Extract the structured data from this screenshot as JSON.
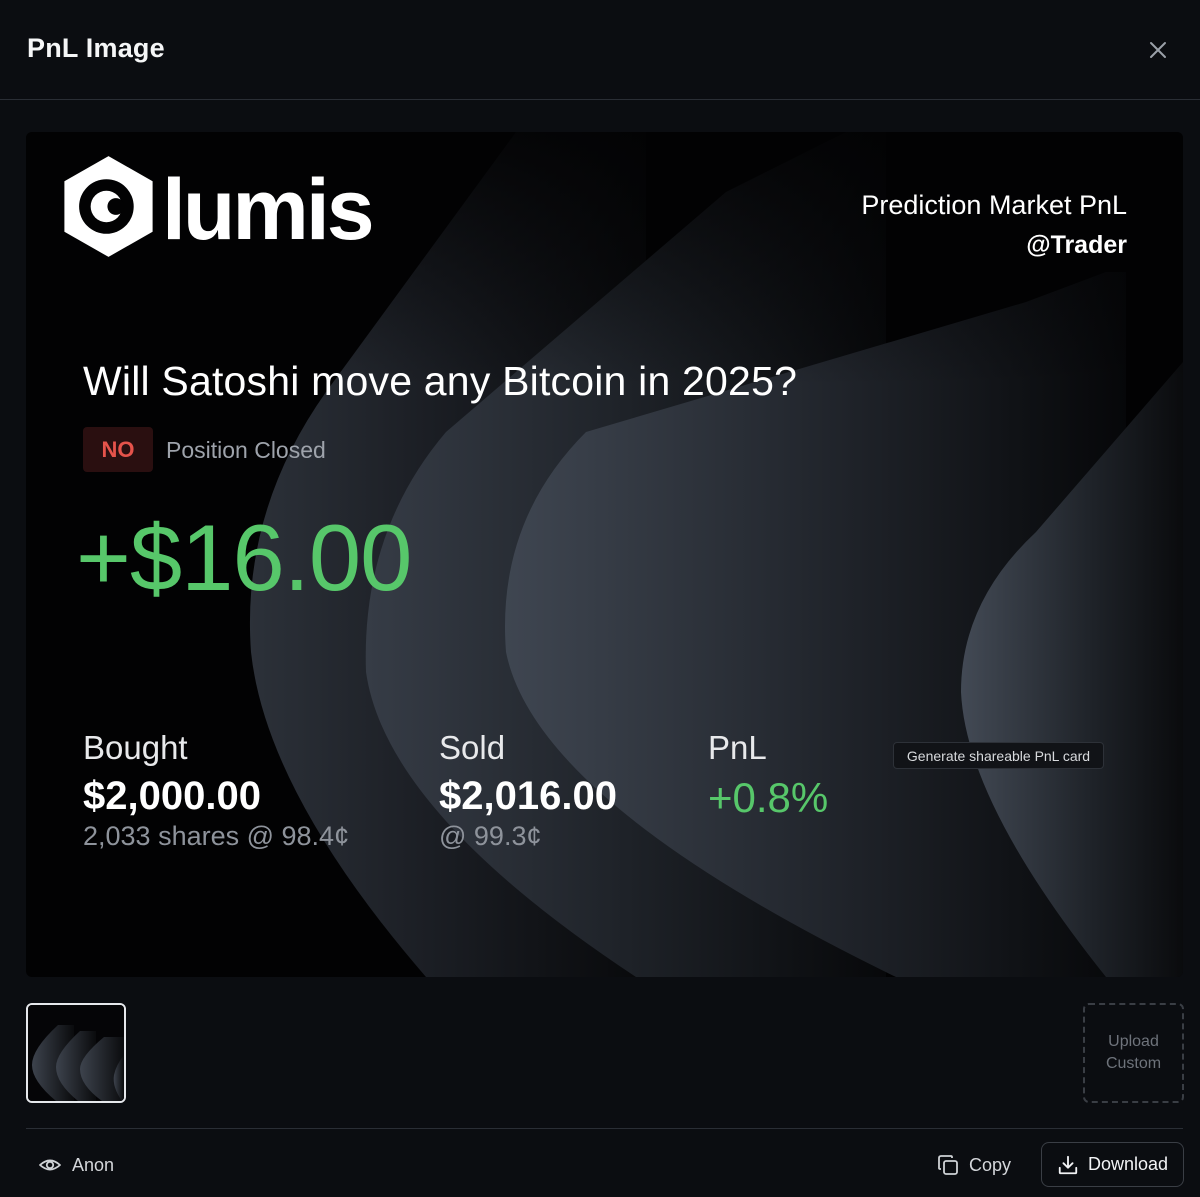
{
  "dialog": {
    "title": "PnL Image",
    "close_icon": "close-icon"
  },
  "card": {
    "brand": "lumis",
    "logo_icon": "lumis-hexagon-logo",
    "subtitle": "Prediction Market PnL",
    "handle": "@Trader",
    "question": "Will Satoshi move any Bitcoin in 2025?",
    "side": "NO",
    "side_color": "#e5534b",
    "status": "Position Closed",
    "pnl_amount": "+$16.00",
    "profit_color": "#57c76a",
    "stats": {
      "bought_label": "Bought",
      "bought_value": "$2,000.00",
      "bought_sub": "2,033 shares @ 98.4¢",
      "sold_label": "Sold",
      "sold_value": "$2,016.00",
      "sold_sub": "@ 99.3¢",
      "pnl_label": "PnL",
      "pnl_value": "+0.8%"
    },
    "tooltip": "Generate shareable PnL card"
  },
  "backgrounds": {
    "upload_line1": "Upload",
    "upload_line2": "Custom"
  },
  "footer": {
    "anon_label": "Anon",
    "anon_icon": "eye-icon",
    "copy_label": "Copy",
    "copy_icon": "copy-icon",
    "download_label": "Download",
    "download_icon": "download-icon"
  }
}
